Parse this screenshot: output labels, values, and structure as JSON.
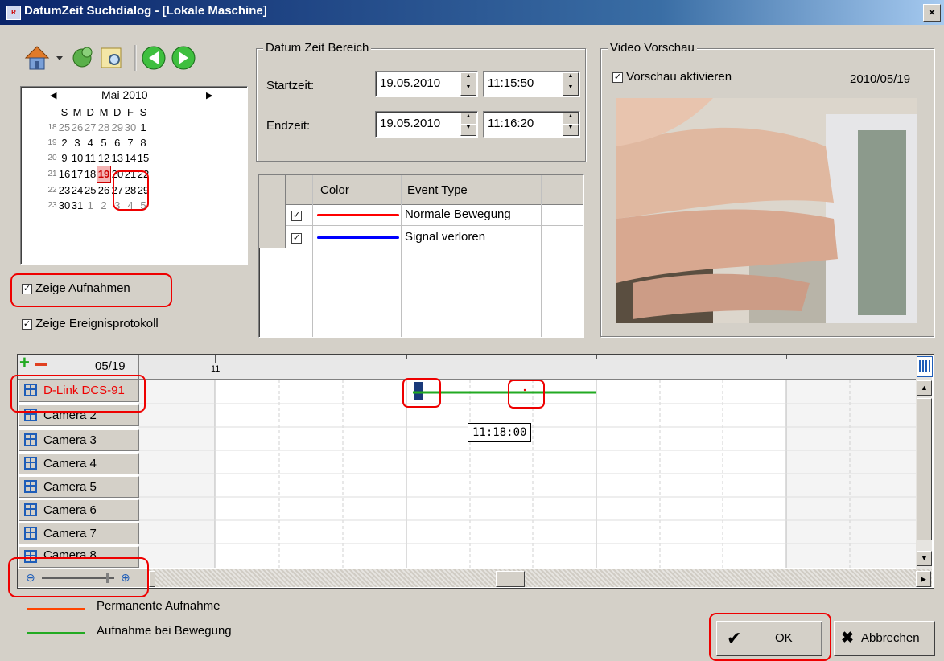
{
  "window": {
    "title": "DatumZeit Suchdialog - [Lokale Maschine]",
    "close_label": "×"
  },
  "calendar": {
    "month_label": "Mai 2010",
    "weekdays": [
      "S",
      "M",
      "D",
      "M",
      "D",
      "F",
      "S"
    ],
    "weeks": [
      {
        "wk": "18",
        "days": [
          "25",
          "26",
          "27",
          "28",
          "29",
          "30",
          "1"
        ]
      },
      {
        "wk": "19",
        "days": [
          "2",
          "3",
          "4",
          "5",
          "6",
          "7",
          "8"
        ]
      },
      {
        "wk": "20",
        "days": [
          "9",
          "10",
          "11",
          "12",
          "13",
          "14",
          "15"
        ]
      },
      {
        "wk": "21",
        "days": [
          "16",
          "17",
          "18",
          "19",
          "20",
          "21",
          "22"
        ]
      },
      {
        "wk": "22",
        "days": [
          "23",
          "24",
          "25",
          "26",
          "27",
          "28",
          "29"
        ]
      },
      {
        "wk": "23",
        "days": [
          "30",
          "31",
          "1",
          "2",
          "3",
          "4",
          "5"
        ]
      }
    ],
    "selected_day": "19"
  },
  "options": {
    "show_recordings": "Zeige Aufnahmen",
    "show_events": "Zeige Ereignisprotokoll"
  },
  "range": {
    "legend": "Datum Zeit Bereich",
    "start_label": "Startzeit:",
    "start_date": "19.05.2010",
    "start_time": "11:15:50",
    "end_label": "Endzeit:",
    "end_date": "19.05.2010",
    "end_time": "11:16:20"
  },
  "events": {
    "headers": {
      "color": "Color",
      "type": "Event Type"
    },
    "rows": [
      {
        "type": "Normale Bewegung",
        "color": "#ff0000"
      },
      {
        "type": "Signal verloren",
        "color": "#0000ff"
      }
    ]
  },
  "preview": {
    "legend": "Video Vorschau",
    "enable_label": "Vorschau aktivieren",
    "date": "2010/05/19"
  },
  "timeline": {
    "date": "05/19",
    "hour_label": "11",
    "tooltip": "11:18:00",
    "cameras": [
      "D-Link DCS-91",
      "Camera 2",
      "Camera 3",
      "Camera 4",
      "Camera 5",
      "Camera 6",
      "Camera 7",
      "Camera 8"
    ]
  },
  "legend_bottom": {
    "permanent": "Permanente Aufnahme",
    "motion": "Aufnahme bei Bewegung",
    "permanent_color": "#ff4400",
    "motion_color": "#22aa22"
  },
  "buttons": {
    "ok": "OK",
    "cancel": "Abbrechen"
  }
}
